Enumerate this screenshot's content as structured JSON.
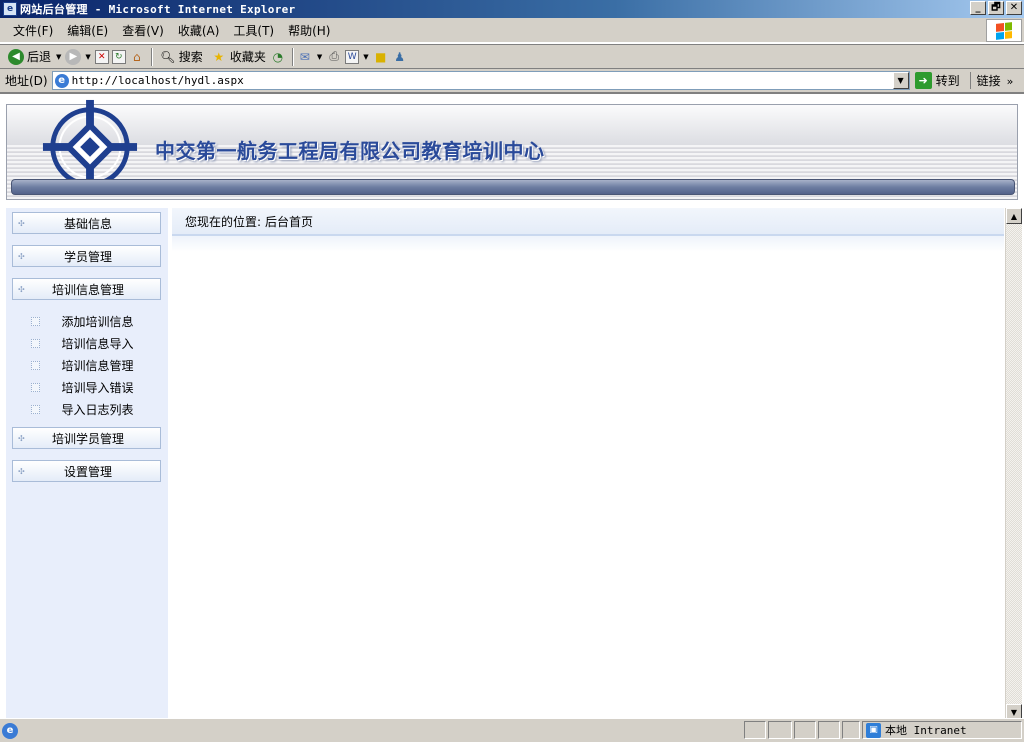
{
  "window": {
    "title": "网站后台管理 - Microsoft Internet Explorer",
    "buttons": {
      "minimize": "_",
      "maximize": "🗗",
      "close": "✕"
    }
  },
  "menu": {
    "items": [
      "文件(F)",
      "编辑(E)",
      "查看(V)",
      "收藏(A)",
      "工具(T)",
      "帮助(H)"
    ]
  },
  "toolbar": {
    "back_label": "后退",
    "search_label": "搜索",
    "favorites_label": "收藏夹"
  },
  "address": {
    "label": "地址(D)",
    "url": "http://localhost/hydl.aspx",
    "go_label": "转到",
    "links_label": "链接"
  },
  "banner": {
    "title": "中交第一航务工程局有限公司教育培训中心"
  },
  "sidebar": {
    "sections": [
      {
        "label": "基础信息"
      },
      {
        "label": "学员管理"
      },
      {
        "label": "培训信息管理"
      },
      {
        "label": "培训学员管理"
      },
      {
        "label": "设置管理"
      }
    ],
    "submenu": [
      {
        "label": "添加培训信息"
      },
      {
        "label": "培训信息导入"
      },
      {
        "label": "培训信息管理"
      },
      {
        "label": "培训导入错误"
      },
      {
        "label": "导入日志列表"
      }
    ]
  },
  "breadcrumb": {
    "prefix": "您现在的位置:",
    "current": "后台首页"
  },
  "status": {
    "zone": "本地 Intranet"
  },
  "colors": {
    "title_bar": "#0a246a",
    "banner_text": "#2a4a9a",
    "sidebar_bg": "#e8eefb",
    "chrome": "#d4d0c8"
  }
}
